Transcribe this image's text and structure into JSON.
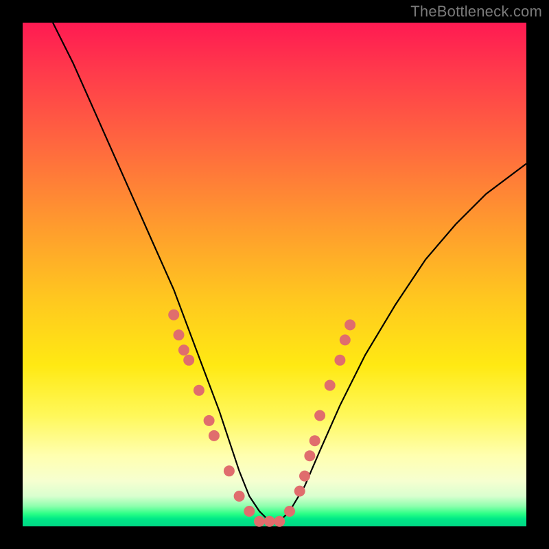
{
  "watermark": "TheBottleneck.com",
  "colors": {
    "frame": "#000000",
    "gradient_top": "#ff1a52",
    "gradient_mid": "#ffe913",
    "gradient_bottom": "#00d885",
    "curve": "#000000",
    "dots": "#e06d6d"
  },
  "chart_data": {
    "type": "line",
    "title": "",
    "xlabel": "",
    "ylabel": "",
    "xlim": [
      0,
      100
    ],
    "ylim": [
      0,
      100
    ],
    "grid": false,
    "series": [
      {
        "name": "bottleneck-curve",
        "x": [
          6,
          10,
          14,
          18,
          22,
          26,
          30,
          33,
          36,
          39,
          41,
          43,
          45,
          47,
          49,
          51,
          53,
          56,
          59,
          63,
          68,
          74,
          80,
          86,
          92,
          100
        ],
        "y": [
          100,
          92,
          83,
          74,
          65,
          56,
          47,
          39,
          31,
          23,
          17,
          11,
          6,
          3,
          1,
          1,
          3,
          8,
          15,
          24,
          34,
          44,
          53,
          60,
          66,
          72
        ]
      }
    ],
    "markers": [
      {
        "x": 30,
        "y": 42
      },
      {
        "x": 31,
        "y": 38
      },
      {
        "x": 32,
        "y": 35
      },
      {
        "x": 33,
        "y": 33
      },
      {
        "x": 35,
        "y": 27
      },
      {
        "x": 37,
        "y": 21
      },
      {
        "x": 38,
        "y": 18
      },
      {
        "x": 41,
        "y": 11
      },
      {
        "x": 43,
        "y": 6
      },
      {
        "x": 45,
        "y": 3
      },
      {
        "x": 47,
        "y": 1
      },
      {
        "x": 49,
        "y": 1
      },
      {
        "x": 51,
        "y": 1
      },
      {
        "x": 53,
        "y": 3
      },
      {
        "x": 55,
        "y": 7
      },
      {
        "x": 56,
        "y": 10
      },
      {
        "x": 57,
        "y": 14
      },
      {
        "x": 58,
        "y": 17
      },
      {
        "x": 59,
        "y": 22
      },
      {
        "x": 61,
        "y": 28
      },
      {
        "x": 63,
        "y": 33
      },
      {
        "x": 64,
        "y": 37
      },
      {
        "x": 65,
        "y": 40
      }
    ]
  }
}
